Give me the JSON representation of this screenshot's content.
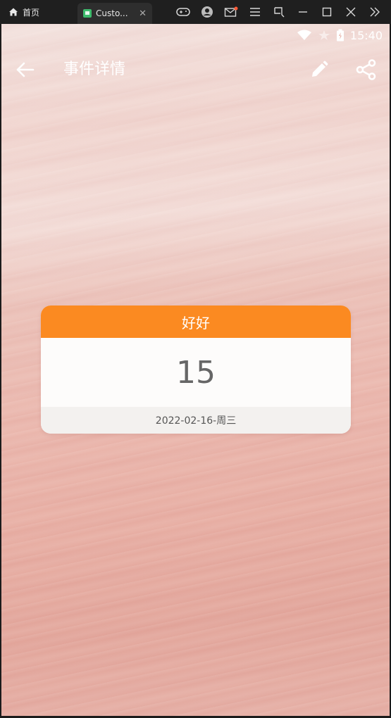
{
  "window": {
    "home_label": "首页",
    "tab_label": "Custo...",
    "icons": [
      "home-icon",
      "app-favicon",
      "tab-close-icon",
      "gamepad-icon",
      "account-icon",
      "mail-icon",
      "menu-icon",
      "crop-icon",
      "minimize-icon",
      "maximize-icon",
      "close-icon",
      "expand-icon"
    ]
  },
  "status": {
    "time": "15:40",
    "icons": [
      "wifi-icon",
      "star-icon",
      "battery-icon"
    ]
  },
  "appbar": {
    "title": "事件详情",
    "icons": [
      "back-arrow-icon",
      "edit-pencil-icon",
      "share-icon"
    ]
  },
  "event_card": {
    "title": "好好",
    "days": "15",
    "date": "2022-02-16-周三",
    "header_color": "#fb8a21"
  }
}
